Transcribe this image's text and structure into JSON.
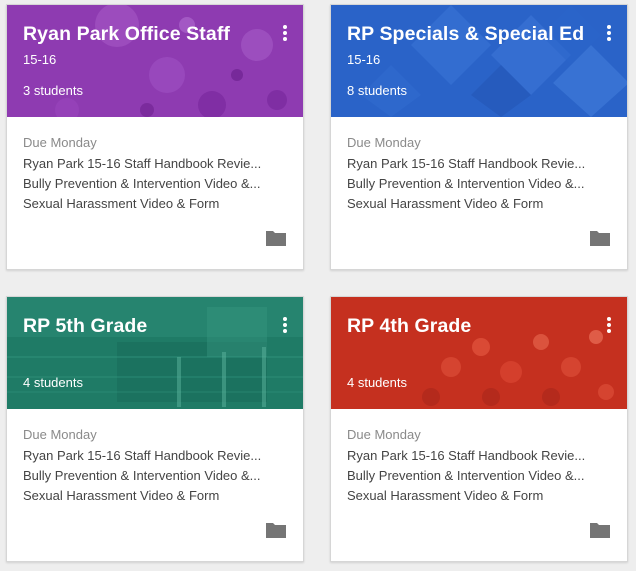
{
  "colors": {
    "purple": "#8e3bb1",
    "blue": "#2a63c8",
    "green": "#1f7b66",
    "red": "#c5301f",
    "folder_icon": "#757575"
  },
  "cards": [
    {
      "title": "Ryan Park Office Staff",
      "section": "15-16",
      "students": "3 students",
      "due": "Due Monday",
      "assignments": [
        "Ryan Park 15-16 Staff Handbook Revie...",
        "Bully Prevention & Intervention Video &...",
        "Sexual Harassment Video & Form"
      ],
      "icons": {
        "menu": "more-vert-icon",
        "folder": "folder-icon"
      }
    },
    {
      "title": "RP Specials & Special Ed",
      "section": "15-16",
      "students": "8 students",
      "due": "Due Monday",
      "assignments": [
        "Ryan Park 15-16 Staff Handbook Revie...",
        "Bully Prevention & Intervention Video &...",
        "Sexual Harassment Video & Form"
      ],
      "icons": {
        "menu": "more-vert-icon",
        "folder": "folder-icon"
      }
    },
    {
      "title": "RP 5th Grade",
      "section": "",
      "students": "4 students",
      "due": "Due Monday",
      "assignments": [
        "Ryan Park 15-16 Staff Handbook Revie...",
        "Bully Prevention & Intervention Video &...",
        "Sexual Harassment Video & Form"
      ],
      "icons": {
        "menu": "more-vert-icon",
        "folder": "folder-icon"
      }
    },
    {
      "title": "RP 4th Grade",
      "section": "",
      "students": "4 students",
      "due": "Due Monday",
      "assignments": [
        "Ryan Park 15-16 Staff Handbook Revie...",
        "Bully Prevention & Intervention Video &...",
        "Sexual Harassment Video & Form"
      ],
      "icons": {
        "menu": "more-vert-icon",
        "folder": "folder-icon"
      }
    }
  ]
}
